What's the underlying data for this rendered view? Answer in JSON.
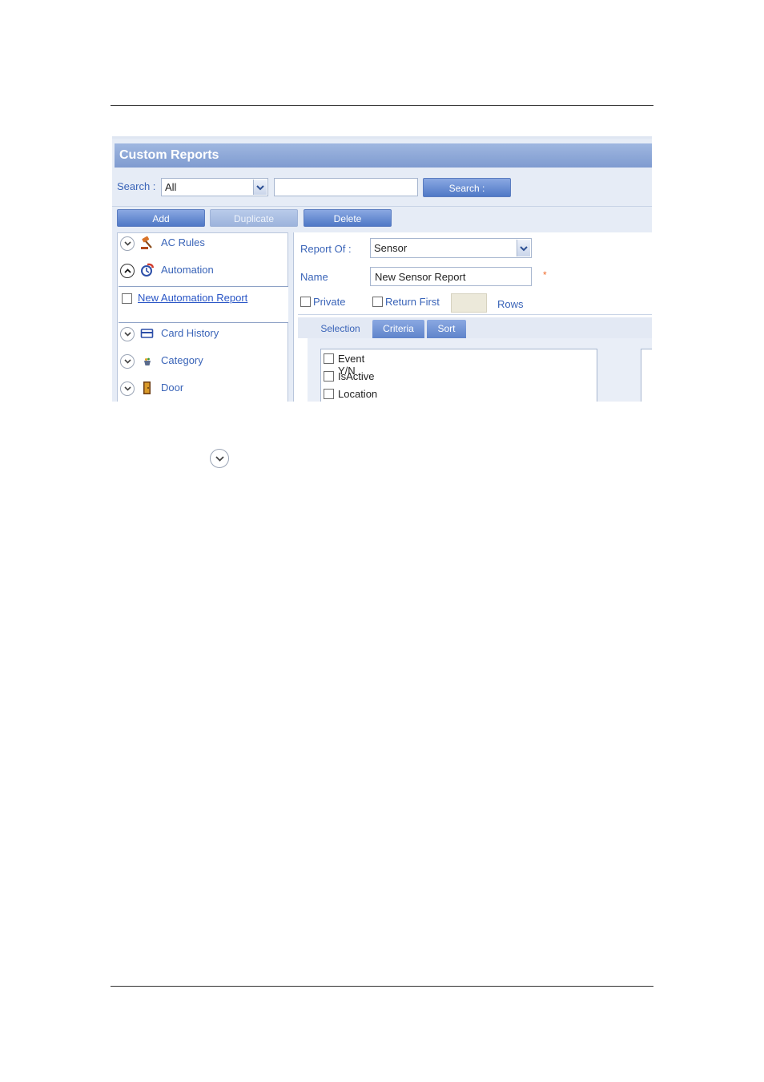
{
  "window": {
    "title": "Custom Reports"
  },
  "search": {
    "label": "Search :",
    "scope_value": "All",
    "query_value": "",
    "button_label": "Search :"
  },
  "toolbar": {
    "add_label": "Add",
    "duplicate_label": "Duplicate",
    "delete_label": "Delete"
  },
  "tree": {
    "items": [
      {
        "label": "AC Rules",
        "icon": "gavel-icon",
        "expanded": false
      },
      {
        "label": "Automation",
        "icon": "automation-icon",
        "expanded": true
      },
      {
        "label": "Card History",
        "icon": "card-icon",
        "expanded": false
      },
      {
        "label": "Category",
        "icon": "category-icon",
        "expanded": false
      },
      {
        "label": "Door",
        "icon": "door-icon",
        "expanded": false
      }
    ],
    "child": {
      "label": "New Automation Report"
    }
  },
  "form": {
    "report_of_label": "Report Of :",
    "report_of_value": "Sensor",
    "name_label": "Name",
    "name_value": "New Sensor Report",
    "required_mark": "*",
    "private_label": "Private",
    "return_first_label": "Return First",
    "rows_label": "Rows"
  },
  "tabs": [
    {
      "label": "Selection",
      "active": false
    },
    {
      "label": "Criteria",
      "active": true
    },
    {
      "label": "Sort",
      "active": true
    }
  ],
  "fields": [
    "Event Y/N",
    "IsActive",
    "Location"
  ],
  "colors": {
    "accent": "#4f78c6",
    "link": "#3a64b8",
    "header": "#8aa6da"
  }
}
